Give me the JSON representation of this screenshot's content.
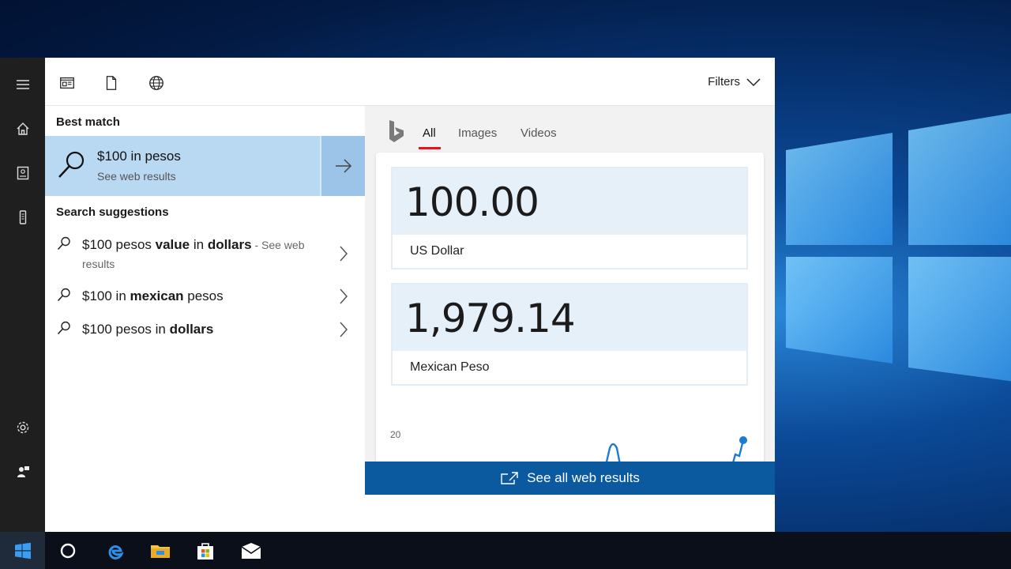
{
  "panel": {
    "filters_label": "Filters",
    "best_match_heading": "Best match",
    "best_match": {
      "title": "$100 in pesos",
      "subtitle": "See web results"
    },
    "suggestions_heading": "Search suggestions",
    "suggestions": [
      {
        "parts": [
          {
            "t": "$100 pesos ",
            "b": false
          },
          {
            "t": "value",
            "b": true
          },
          {
            "t": " in ",
            "b": false
          },
          {
            "t": "dollars",
            "b": true
          }
        ],
        "extra": " - See web results"
      },
      {
        "parts": [
          {
            "t": "$100 in ",
            "b": false
          },
          {
            "t": "mexican",
            "b": true
          },
          {
            "t": " pesos",
            "b": false
          }
        ],
        "extra": ""
      },
      {
        "parts": [
          {
            "t": "$100 pesos in ",
            "b": false
          },
          {
            "t": "dollars",
            "b": true
          }
        ],
        "extra": ""
      }
    ],
    "search_value": "$100 in pesos"
  },
  "preview": {
    "tabs": [
      "All",
      "Images",
      "Videos"
    ],
    "active_tab": "All",
    "converter": [
      {
        "amount": "100.00",
        "unit": "US Dollar"
      },
      {
        "amount": "1,979.14",
        "unit": "Mexican Peso"
      }
    ],
    "chart_axis_label": "20",
    "see_all_label": "See all web results"
  },
  "colors": {
    "accent": "#0b5aa0",
    "highlight": "#b9d8f2",
    "tab_underline": "#e81123"
  },
  "icons": {
    "rail": [
      "hamburger-icon",
      "home-icon",
      "notebook-icon",
      "device-icon",
      "settings-icon",
      "feedback-icon"
    ],
    "topbar": [
      "apps-icon",
      "documents-icon",
      "web-icon"
    ],
    "taskbar": [
      "windows-start-icon",
      "cortana-icon",
      "edge-icon",
      "file-explorer-icon",
      "store-icon",
      "mail-icon"
    ]
  }
}
